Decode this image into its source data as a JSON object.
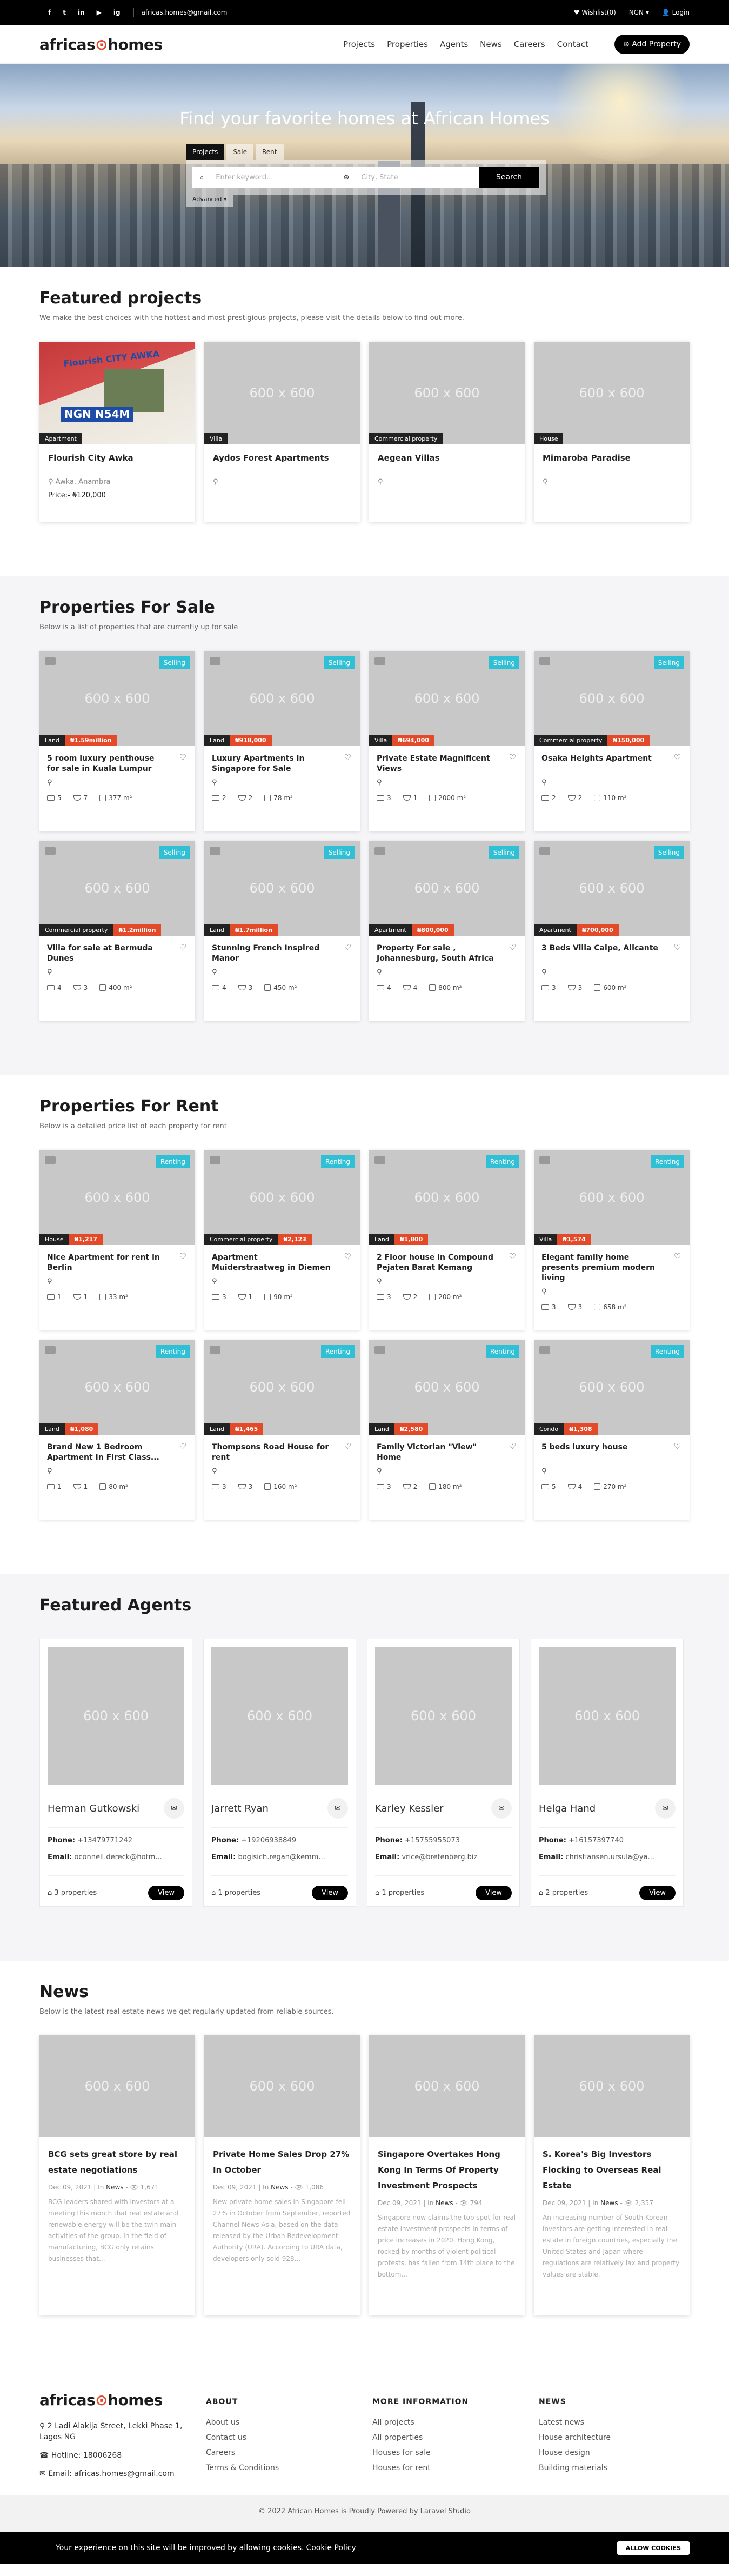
{
  "topbar": {
    "social": [
      "f",
      "t",
      "in",
      "▶",
      "ig"
    ],
    "email": "africas.homes@gmail.com",
    "currency": "NGN ▾",
    "wishlist": "♥ Wishlist(0)",
    "login": "👤 Login"
  },
  "header": {
    "logo_a": "africas",
    "logo_b": "homes",
    "nav": [
      "Projects",
      "Properties",
      "Agents",
      "News",
      "Careers",
      "Contact"
    ],
    "add_property": "⊕ Add Property"
  },
  "hero": {
    "title": "Find your favorite homes at African Homes",
    "tabs": [
      "Projects",
      "Sale",
      "Rent"
    ],
    "keyword_placeholder": "Enter keyword...",
    "city_placeholder": "City, State",
    "search": "Search",
    "advanced": "Advanced ▾"
  },
  "featured": {
    "title": "Featured projects",
    "subtitle": "We make the best choices with the hottest and most prestigious projects, please visit the details below to find out more.",
    "items": [
      {
        "tag": "Apartment",
        "name": "Flourish City Awka",
        "location": "Awka, Anambra",
        "price": "Price:- ₦120,000",
        "flyer_title": "Flourish CITY AWKA",
        "flyer_sub": "NGN N54M"
      },
      {
        "tag": "Villa",
        "name": "Aydos Forest Apartments",
        "location": "",
        "price": ""
      },
      {
        "tag": "Commercial property",
        "name": "Aegean Villas",
        "location": "",
        "price": ""
      },
      {
        "tag": "House",
        "name": "Mimaroba Paradise",
        "location": "",
        "price": ""
      }
    ]
  },
  "placeholder": "600 x 600",
  "sale": {
    "title": "Properties For Sale",
    "subtitle": "Below is a list of properties that are currently up for sale",
    "items": [
      {
        "status": "Selling",
        "type": "Land",
        "price": "₦1.59million",
        "title": "5 room luxury penthouse for sale in Kuala Lumpur",
        "beds": "5",
        "baths": "7",
        "area": "377 m²"
      },
      {
        "status": "Selling",
        "type": "Land",
        "price": "₦918,000",
        "title": "Luxury Apartments in Singapore for Sale",
        "beds": "2",
        "baths": "2",
        "area": "78 m²"
      },
      {
        "status": "Selling",
        "type": "Villa",
        "price": "₦694,000",
        "title": "Private Estate Magnificent Views",
        "beds": "3",
        "baths": "1",
        "area": "2000 m²"
      },
      {
        "status": "Selling",
        "type": "Commercial property",
        "price": "₦150,000",
        "title": "Osaka Heights Apartment",
        "beds": "2",
        "baths": "2",
        "area": "110 m²"
      },
      {
        "status": "Selling",
        "type": "Commercial property",
        "price": "₦1.2million",
        "title": "Villa for sale at Bermuda Dunes",
        "beds": "4",
        "baths": "3",
        "area": "400 m²"
      },
      {
        "status": "Selling",
        "type": "Land",
        "price": "₦1.7million",
        "title": "Stunning French Inspired Manor",
        "beds": "4",
        "baths": "3",
        "area": "450 m²"
      },
      {
        "status": "Selling",
        "type": "Apartment",
        "price": "₦800,000",
        "title": "Property For sale , Johannesburg, South Africa",
        "beds": "4",
        "baths": "4",
        "area": "800 m²"
      },
      {
        "status": "Selling",
        "type": "Apartment",
        "price": "₦700,000",
        "title": "3 Beds Villa Calpe, Alicante",
        "beds": "3",
        "baths": "3",
        "area": "600 m²"
      }
    ]
  },
  "rent": {
    "title": "Properties For Rent",
    "subtitle": "Below is a detailed price list of each property for rent",
    "items": [
      {
        "status": "Renting",
        "type": "House",
        "price": "₦1,217",
        "title": "Nice Apartment for rent in Berlin",
        "beds": "1",
        "baths": "1",
        "area": "33 m²"
      },
      {
        "status": "Renting",
        "type": "Commercial property",
        "price": "₦2,123",
        "title": "Apartment Muiderstraatweg in Diemen",
        "beds": "3",
        "baths": "1",
        "area": "90 m²"
      },
      {
        "status": "Renting",
        "type": "Land",
        "price": "₦1,800",
        "title": "2 Floor house in Compound Pejaten Barat Kemang",
        "beds": "3",
        "baths": "2",
        "area": "200 m²"
      },
      {
        "status": "Renting",
        "type": "Villa",
        "price": "₦1,574",
        "title": "Elegant family home presents premium modern living",
        "beds": "3",
        "baths": "3",
        "area": "658 m²"
      },
      {
        "status": "Renting",
        "type": "Land",
        "price": "₦1,080",
        "title": "Brand New 1 Bedroom Apartment In First Class...",
        "beds": "1",
        "baths": "1",
        "area": "80 m²"
      },
      {
        "status": "Renting",
        "type": "Land",
        "price": "₦1,465",
        "title": "Thompsons Road House for rent",
        "beds": "3",
        "baths": "3",
        "area": "160 m²"
      },
      {
        "status": "Renting",
        "type": "Land",
        "price": "₦2,580",
        "title": "Family Victorian \"View\" Home",
        "beds": "3",
        "baths": "2",
        "area": "180 m²"
      },
      {
        "status": "Renting",
        "type": "Condo",
        "price": "₦1,308",
        "title": "5 beds luxury house",
        "beds": "5",
        "baths": "4",
        "area": "270 m²"
      }
    ]
  },
  "agents": {
    "title": "Featured Agents",
    "phone_label": "Phone:",
    "email_label": "Email:",
    "view": "View",
    "items": [
      {
        "name": "Herman Gutkowski",
        "phone": "+13479771242",
        "email": "oconnell.dereck@hotm...",
        "props": "3 properties"
      },
      {
        "name": "Jarrett Ryan",
        "phone": "+19206938849",
        "email": "bogisich.regan@kemm...",
        "props": "1 properties"
      },
      {
        "name": "Karley Kessler",
        "phone": "+15755955073",
        "email": "vrice@bretenberg.biz",
        "props": "1 properties"
      },
      {
        "name": "Helga Hand",
        "phone": "+16157397740",
        "email": "christiansen.ursula@ya...",
        "props": "2 properties"
      }
    ]
  },
  "news": {
    "title": "News",
    "subtitle": "Below is the latest real estate news we get regularly updated from reliable sources.",
    "items": [
      {
        "title": "BCG sets great store by real estate negotiations",
        "date": "Dec 09, 2021",
        "cat": "News",
        "views": "1,671",
        "excerpt": "BCG leaders shared with investors at a meeting this month that real estate and renewable energy will be the twin main activities of the group. In the field of manufacturing, BCG only retains businesses that..."
      },
      {
        "title": "Private Home Sales Drop 27% In October",
        "date": "Dec 09, 2021",
        "cat": "News",
        "views": "1,086",
        "excerpt": "New private home sales in Singapore fell 27% in October from September, reported Channel News Asia, based on the data released by the Urban Redevelopment Authority (URA). According to URA data, developers only sold 928..."
      },
      {
        "title": "Singapore Overtakes Hong Kong In Terms Of Property Investment Prospects",
        "date": "Dec 09, 2021",
        "cat": "News",
        "views": "794",
        "excerpt": "Singapore now claims the top spot for real estate investment prospects in terms of price increases in 2020. Hong Kong, rocked by months of violent political protests, has fallen from 14th place to the bottom..."
      },
      {
        "title": "S. Korea's Big Investors Flocking to Overseas Real Estate",
        "date": "Dec 09, 2021",
        "cat": "News",
        "views": "2,357",
        "excerpt": "An increasing number of South Korean investors are getting interested in real estate in foreign countries, especially the United States and Japan where regulations are relatively lax and property values are stable."
      }
    ]
  },
  "footer": {
    "address": "2 Ladi Alakija Street, Lekki Phase 1, Lagos NG",
    "hotline": "Hotline: 18006268",
    "email": "Email: africas.homes@gmail.com",
    "about_title": "ABOUT",
    "about": [
      "About us",
      "Contact us",
      "Careers",
      "Terms & Conditions"
    ],
    "more_title": "MORE INFORMATION",
    "more": [
      "All projects",
      "All properties",
      "Houses for sale",
      "Houses for rent"
    ],
    "news_title": "NEWS",
    "news": [
      "Latest news",
      "House architecture",
      "House design",
      "Building materials"
    ],
    "copyright": "© 2022 African Homes is Proudly Powered by Laravel Studio"
  },
  "cookie": {
    "text": "Your experience on this site will be improved by allowing cookies.",
    "policy": "Cookie Policy",
    "allow": "ALLOW COOKIES"
  }
}
